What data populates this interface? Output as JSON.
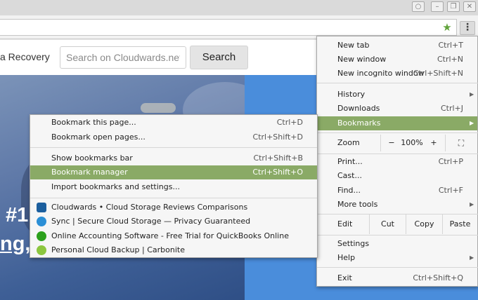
{
  "window": {
    "controls": [
      "user-icon",
      "minimize-icon",
      "restore-icon",
      "close-icon"
    ]
  },
  "toolbar": {
    "bookmark_star": "star-icon",
    "menu_button": "kebab-menu-icon",
    "accent_color": "#61a33b"
  },
  "page": {
    "nav_fragment": "a Recovery",
    "search_placeholder": "Search on Cloudwards.net",
    "search_button": "Search",
    "hero_line1": "#1",
    "hero_line2": "ng,"
  },
  "chrome_menu": {
    "highlight_color": "#8aaa66",
    "new_tab": {
      "label": "New tab",
      "shortcut": "Ctrl+T"
    },
    "new_window": {
      "label": "New window",
      "shortcut": "Ctrl+N"
    },
    "new_incognito": {
      "label": "New incognito window",
      "shortcut": "Ctrl+Shift+N"
    },
    "history": {
      "label": "History"
    },
    "downloads": {
      "label": "Downloads",
      "shortcut": "Ctrl+J"
    },
    "bookmarks": {
      "label": "Bookmarks"
    },
    "zoom": {
      "label": "Zoom",
      "minus": "−",
      "level": "100%",
      "plus": "+"
    },
    "print": {
      "label": "Print...",
      "shortcut": "Ctrl+P"
    },
    "cast": {
      "label": "Cast..."
    },
    "find": {
      "label": "Find...",
      "shortcut": "Ctrl+F"
    },
    "more_tools": {
      "label": "More tools"
    },
    "edit": {
      "label": "Edit",
      "cut": "Cut",
      "copy": "Copy",
      "paste": "Paste"
    },
    "settings": {
      "label": "Settings"
    },
    "help": {
      "label": "Help"
    },
    "exit": {
      "label": "Exit",
      "shortcut": "Ctrl+Shift+Q"
    }
  },
  "bookmarks_menu": {
    "bookmark_page": {
      "label": "Bookmark this page...",
      "shortcut": "Ctrl+D"
    },
    "bookmark_open": {
      "label": "Bookmark open pages...",
      "shortcut": "Ctrl+Shift+D"
    },
    "show_bar": {
      "label": "Show bookmarks bar",
      "shortcut": "Ctrl+Shift+B"
    },
    "manager": {
      "label": "Bookmark manager",
      "shortcut": "Ctrl+Shift+O"
    },
    "import": {
      "label": "Import bookmarks and settings..."
    },
    "items": [
      {
        "label": "Cloudwards • Cloud Storage Reviews  Comparisons",
        "icon": "cloud-icon",
        "color": "#1c5f9e"
      },
      {
        "label": "Sync | Secure Cloud Storage — Privacy Guaranteed",
        "icon": "sync-icon",
        "color": "#2b8fd6"
      },
      {
        "label": "Online Accounting Software - Free Trial for QuickBooks Online",
        "icon": "quickbooks-icon",
        "color": "#2ca01c"
      },
      {
        "label": "Personal Cloud Backup | Carbonite",
        "icon": "carbonite-icon",
        "color": "#8cc63f"
      }
    ]
  }
}
